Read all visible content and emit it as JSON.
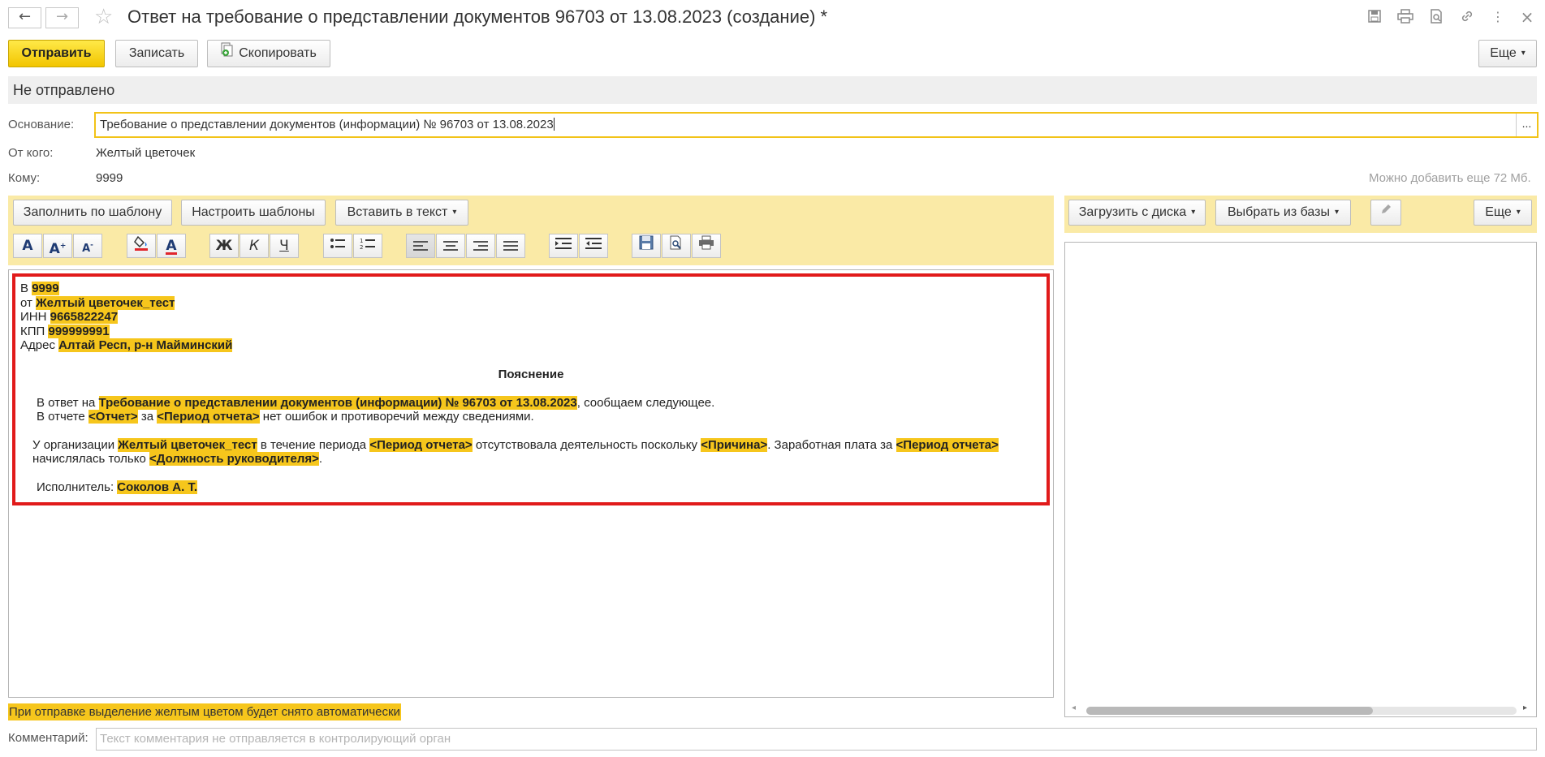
{
  "window": {
    "title": "Ответ на требование о представлении документов 96703 от 13.08.2023 (создание) *"
  },
  "toolbar": {
    "send": "Отправить",
    "save": "Записать",
    "copy": "Скопировать",
    "more": "Еще"
  },
  "status": "Не отправлено",
  "fields": {
    "basis_label": "Основание:",
    "basis_value": "Требование о представлении документов (информации) № 96703 от 13.08.2023",
    "basis_select": "...",
    "from_label": "От кого:",
    "from_value": "Желтый цветочек",
    "to_label": "Кому:",
    "to_value": "9999",
    "limit_note": "Можно добавить еще 72 Мб."
  },
  "editor_toolbar": {
    "fill_template": "Заполнить по шаблону",
    "setup_templates": "Настроить шаблоны",
    "insert_text": "Вставить в текст",
    "bold": "Ж",
    "italic": "К",
    "underline": "Ч"
  },
  "attachments_toolbar": {
    "upload": "Загрузить с диска",
    "choose": "Выбрать из базы",
    "more": "Еще"
  },
  "letter": {
    "to_prefix": "В",
    "to_value": "9999",
    "from_prefix": "от",
    "from_value": "Желтый цветочек_тест",
    "inn_label": "ИНН",
    "inn_value": "9665822247",
    "kpp_label": "КПП",
    "kpp_value": "999999991",
    "address_label": "Адрес",
    "address_value": "Алтай Респ, р-н Майминский",
    "heading": "Пояснение",
    "p1_a": "В ответ на",
    "p1_b": "Требование о представлении документов (информации) № 96703 от 13.08.2023",
    "p1_c": ", сообщаем следующее.",
    "p2_a": "В отчете",
    "p2_b": "<Отчет>",
    "p2_c": "за",
    "p2_d": "<Период отчета>",
    "p2_e": "нет ошибок и противоречий между сведениями.",
    "p3_a": "У организации",
    "p3_b": "Желтый цветочек_тест",
    "p3_c": "в течение периода",
    "p3_d": "<Период отчета>",
    "p3_e": "отсутствовала деятельность поскольку",
    "p3_f": "<Причина>",
    "p3_g": ". Заработная плата за",
    "p3_h": "<Период отчета>",
    "p3_i": "начислялась только",
    "p3_j": "<Должность руководителя>",
    "p3_k": ".",
    "exec_label": "Исполнитель:",
    "exec_value": "Соколов А. Т."
  },
  "footer": {
    "notice": "При отправке выделение желтым цветом будет снято автоматически",
    "comment_label": "Комментарий:",
    "comment_placeholder": "Текст комментария не отправляется в контролирующий орган"
  },
  "colors": {
    "highlight": "#f6c61c",
    "toolbar_bg": "#faeaa6",
    "frame": "#e11a1a",
    "primary": "#f2c500"
  }
}
